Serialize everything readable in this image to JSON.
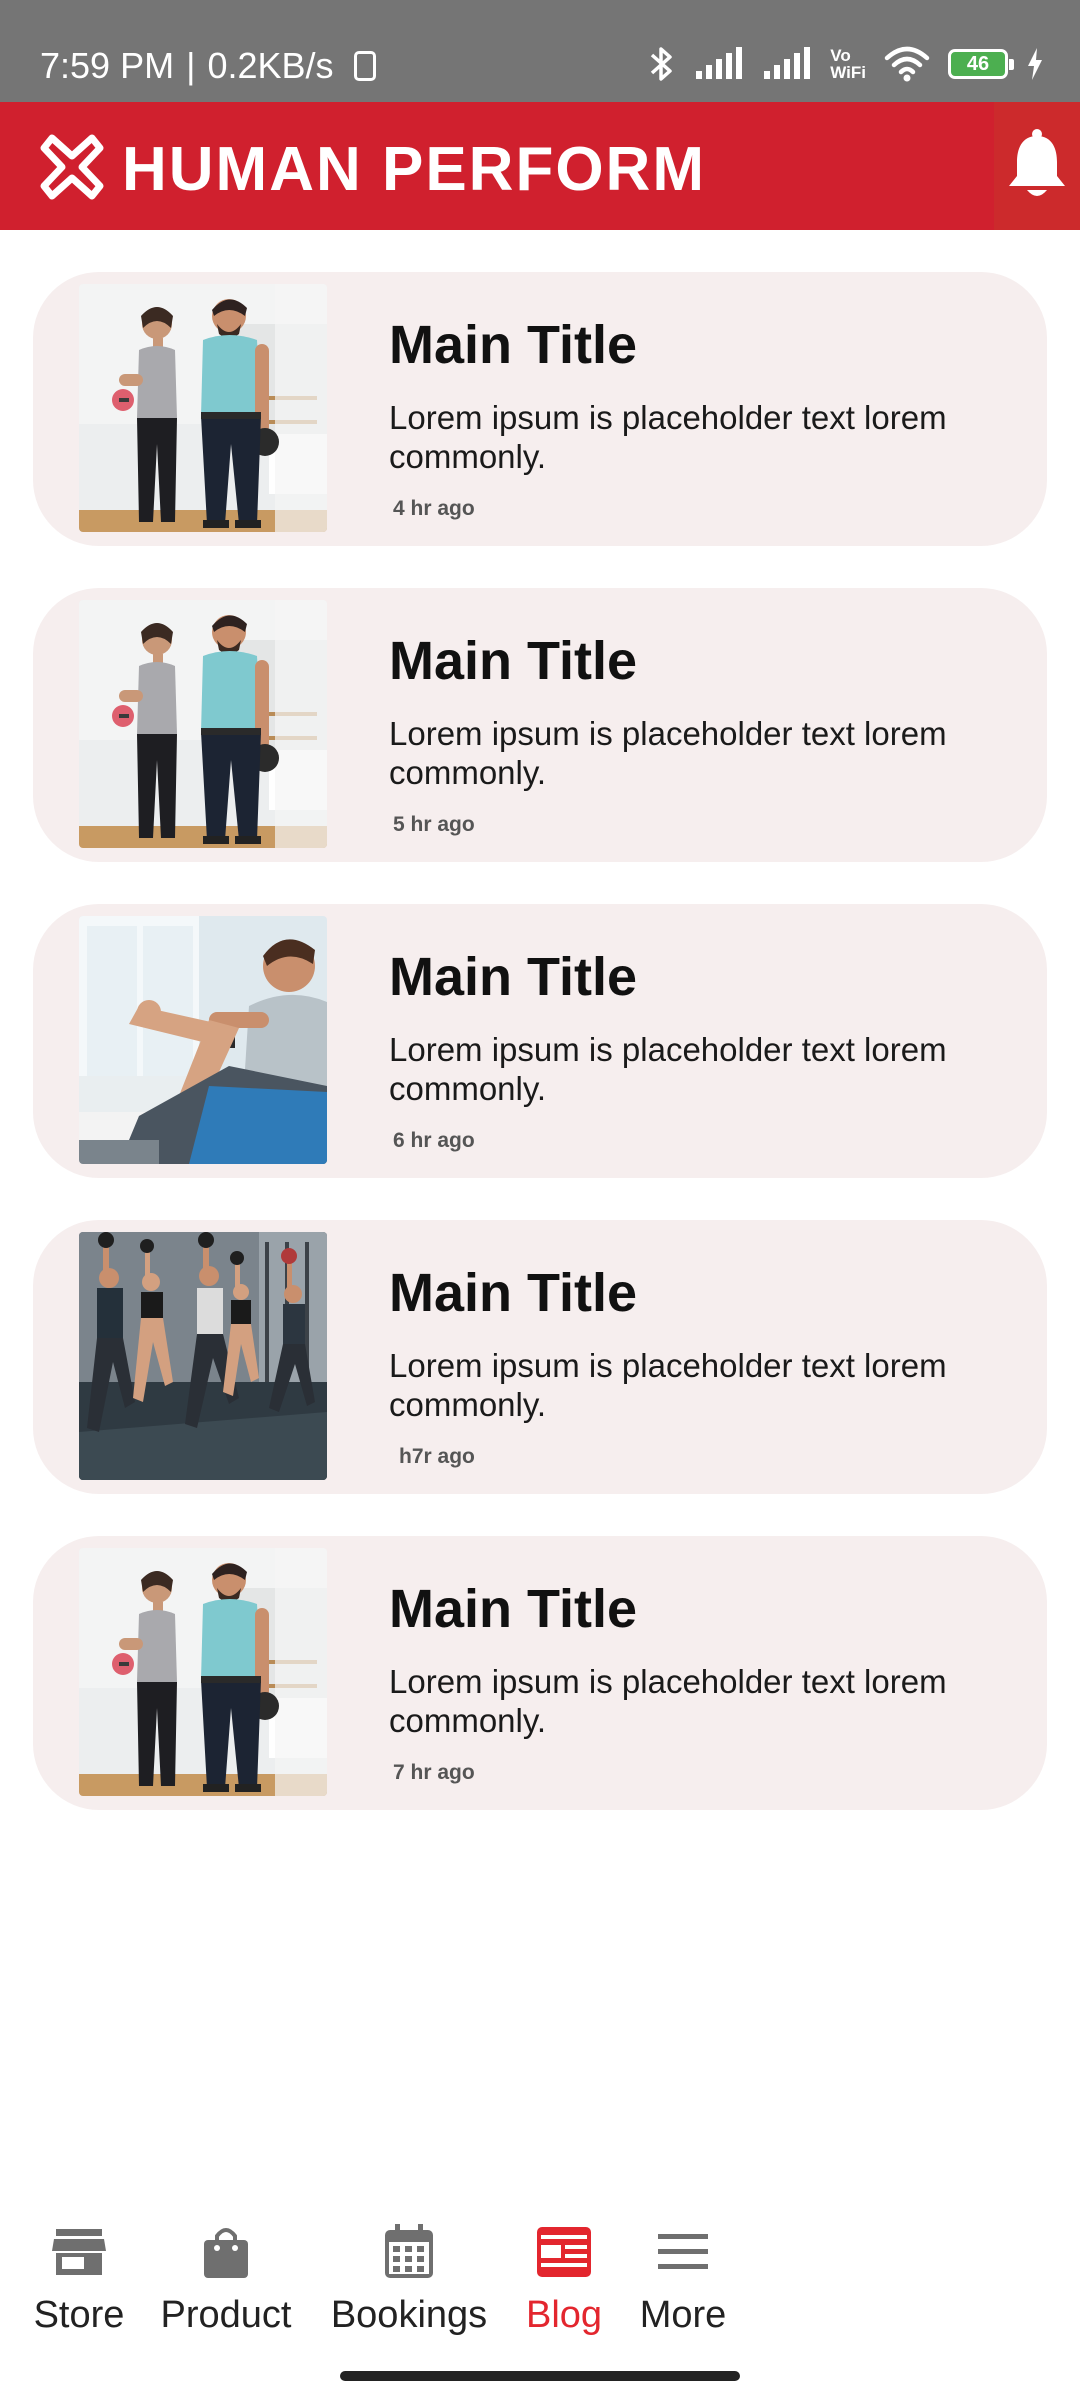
{
  "status_bar": {
    "time": "7:59 PM",
    "separator": "|",
    "speed": "0.2KB/s",
    "vowifi_top": "Vo",
    "vowifi_bottom": "WiFi",
    "battery_level": "46"
  },
  "header": {
    "app_name": "HUMAN PERFORM",
    "brand_color": "#d0202e"
  },
  "posts": [
    {
      "title": "Main Title",
      "description": "Lorem ipsum is placeholder text lorem commonly.",
      "time": "4 hr ago",
      "image": "trainer-with-dumbbells-photo"
    },
    {
      "title": "Main Title",
      "description": "Lorem ipsum is placeholder text lorem commonly.",
      "time": "5 hr ago",
      "image": "trainer-with-dumbbells-photo"
    },
    {
      "title": "Main Title",
      "description": "Lorem ipsum is placeholder text lorem commonly.",
      "time": "6 hr ago",
      "image": "physiotherapy-knee-photo"
    },
    {
      "title": "Main Title",
      "description": "Lorem ipsum is placeholder text lorem commonly.",
      "time": "h7r ago",
      "image": "group-lunge-workout-photo"
    },
    {
      "title": "Main Title",
      "description": "Lorem ipsum is placeholder text lorem commonly.",
      "time": "7 hr ago",
      "image": "trainer-with-dumbbells-photo"
    }
  ],
  "bottom_nav": {
    "items": [
      {
        "label": "Store",
        "icon": "store-icon",
        "active": false
      },
      {
        "label": "Product",
        "icon": "shopping-bag-icon",
        "active": false
      },
      {
        "label": "Bookings",
        "icon": "calendar-icon",
        "active": false
      },
      {
        "label": "Blog",
        "icon": "newspaper-icon",
        "active": true
      },
      {
        "label": "More",
        "icon": "menu-icon",
        "active": false
      }
    ],
    "active_color": "#e3262e",
    "inactive_icon_color": "#6f6f6f"
  }
}
